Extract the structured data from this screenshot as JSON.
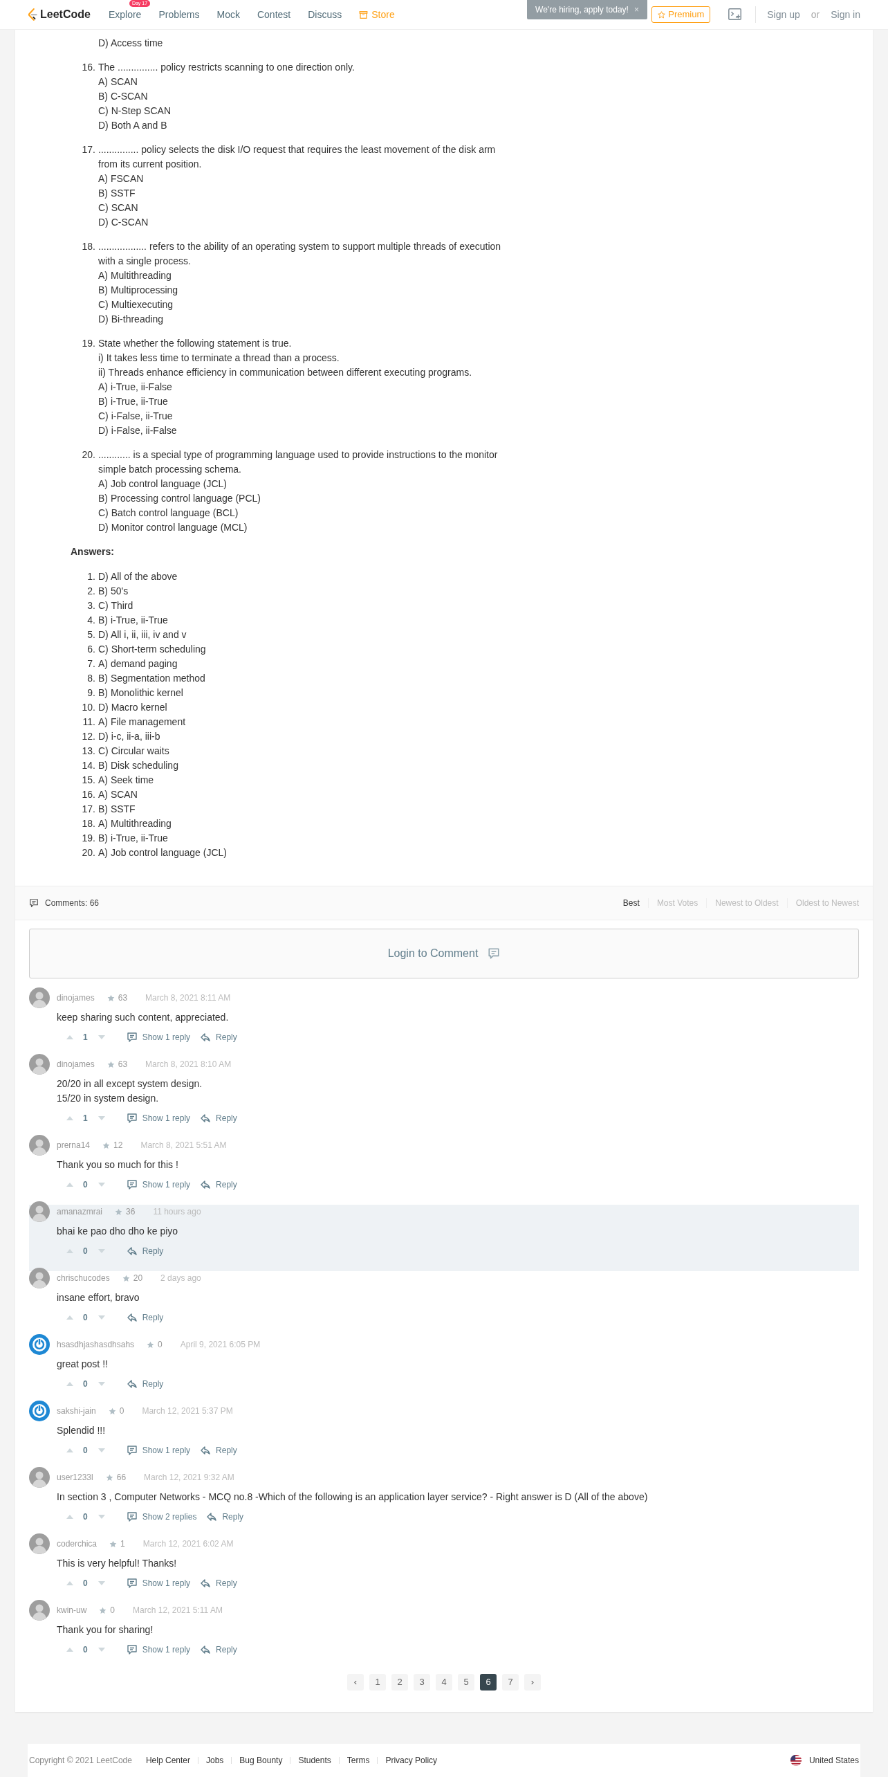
{
  "header": {
    "logo": "LeetCode",
    "nav": [
      {
        "label": "Explore",
        "badge": "Day 17",
        "kind": "link"
      },
      {
        "label": "Problems",
        "kind": "link"
      },
      {
        "label": "Mock",
        "kind": "link"
      },
      {
        "label": "Contest",
        "kind": "link"
      },
      {
        "label": "Discuss",
        "kind": "link"
      },
      {
        "label": "Store",
        "kind": "store"
      }
    ],
    "premium": "Premium",
    "sign_up": "Sign up",
    "or": "or",
    "sign_in": "Sign in",
    "toast": {
      "text": "We're hiring, apply today!",
      "close": "×"
    }
  },
  "partial_question": {
    "options": [
      "D) Access time"
    ]
  },
  "questions": [
    {
      "number": "16.",
      "text_lines": [
        "The ............... policy restricts scanning to one direction only."
      ],
      "options": [
        "A) SCAN",
        "B) C-SCAN",
        "C) N-Step SCAN",
        "D) Both A and B"
      ]
    },
    {
      "number": "17.",
      "text_lines": [
        "............... policy selects the disk I/O request that requires the least movement of the disk arm",
        "from its current position."
      ],
      "options": [
        "A) FSCAN",
        "B) SSTF",
        "C) SCAN",
        "D) C-SCAN"
      ]
    },
    {
      "number": "18.",
      "text_lines": [
        ".................. refers to the ability of an operating system to support multiple threads of execution",
        "with a single process."
      ],
      "options": [
        "A) Multithreading",
        "B) Multiprocessing",
        "C) Multiexecuting",
        "D) Bi-threading"
      ]
    },
    {
      "number": "19.",
      "text_lines": [
        "State whether the following statement is true.",
        "i) It takes less time to terminate a thread than a process.",
        "ii) Threads enhance efficiency in communication between different executing programs."
      ],
      "options": [
        "A) i-True, ii-False",
        "B) i-True, ii-True",
        "C) i-False, ii-True",
        "D) i-False, ii-False"
      ]
    },
    {
      "number": "20.",
      "text_lines": [
        "............ is a special type of programming language used to provide instructions to the monitor",
        "simple batch processing schema."
      ],
      "options": [
        "A) Job control language (JCL)",
        "B) Processing control language (PCL)",
        "C) Batch control language (BCL)",
        "D) Monitor control language (MCL)"
      ]
    }
  ],
  "answers": {
    "heading": "Answers:",
    "items": [
      {
        "number": "1.",
        "text": "D) All of the above"
      },
      {
        "number": "2.",
        "text": "B) 50's"
      },
      {
        "number": "3.",
        "text": "C) Third"
      },
      {
        "number": "4.",
        "text": "B) i-True, ii-True"
      },
      {
        "number": "5.",
        "text": "D) All i, ii, iii, iv and v"
      },
      {
        "number": "6.",
        "text": "C) Short-term scheduling"
      },
      {
        "number": "7.",
        "text": "A) demand paging"
      },
      {
        "number": "8.",
        "text": "B) Segmentation method"
      },
      {
        "number": "9.",
        "text": "B) Monolithic kernel"
      },
      {
        "number": "10.",
        "text": "D) Macro kernel"
      },
      {
        "number": "11.",
        "text": "A) File management"
      },
      {
        "number": "12.",
        "text": "D) i-c, ii-a, iii-b"
      },
      {
        "number": "13.",
        "text": "C) Circular waits"
      },
      {
        "number": "14.",
        "text": "B) Disk scheduling"
      },
      {
        "number": "15.",
        "text": "A) Seek time"
      },
      {
        "number": "16.",
        "text": "A) SCAN"
      },
      {
        "number": "17.",
        "text": "B) SSTF"
      },
      {
        "number": "18.",
        "text": "A) Multithreading"
      },
      {
        "number": "19.",
        "text": "B) i-True, ii-True"
      },
      {
        "number": "20.",
        "text": "A) Job control language (JCL)"
      }
    ]
  },
  "comments_bar": {
    "count_label": "Comments: 66",
    "sort_tabs": [
      {
        "label": "Best",
        "selected": true
      },
      {
        "label": "Most Votes",
        "selected": false
      },
      {
        "label": "Newest to Oldest",
        "selected": false
      },
      {
        "label": "Oldest to Newest",
        "selected": false
      }
    ]
  },
  "login_to_comment": "Login to Comment",
  "comments": [
    {
      "user": "dinojames",
      "kind": "photo",
      "reputation": "63",
      "date": "March 8, 2021 8:11 AM",
      "body": [
        "keep sharing such content, appreciated."
      ],
      "votes": "1",
      "replies": "Show 1 reply",
      "reply": "Reply",
      "highlighted": false
    },
    {
      "user": "dinojames",
      "kind": "photo",
      "reputation": "63",
      "date": "March 8, 2021 8:10 AM",
      "body": [
        "20/20 in all except system design.",
        "15/20 in system design."
      ],
      "votes": "1",
      "replies": "Show 1 reply",
      "reply": "Reply",
      "highlighted": false
    },
    {
      "user": "prerna14",
      "kind": "photo",
      "reputation": "12",
      "date": "March 8, 2021 5:51 AM",
      "body": [
        "Thank you so much for this !"
      ],
      "votes": "0",
      "replies": "Show 1 reply",
      "reply": "Reply",
      "highlighted": false
    },
    {
      "user": "amanazmrai",
      "kind": "photo",
      "reputation": "36",
      "date": "11 hours ago",
      "body": [
        "bhai ke pao dho dho ke piyo"
      ],
      "votes": "0",
      "reply": "Reply",
      "highlighted": true
    },
    {
      "user": "chrischucodes",
      "kind": "photo",
      "reputation": "20",
      "date": "2 days ago",
      "body": [
        "insane effort, bravo"
      ],
      "votes": "0",
      "reply": "Reply",
      "highlighted": false
    },
    {
      "user": "hsasdhjashasdhsahs",
      "kind": "default",
      "reputation": "0",
      "date": "April 9, 2021 6:05 PM",
      "body": [
        "great post !!"
      ],
      "votes": "0",
      "reply": "Reply",
      "highlighted": false
    },
    {
      "user": "sakshi-jain",
      "kind": "default",
      "reputation": "0",
      "date": "March 12, 2021 5:37 PM",
      "body": [
        "Splendid !!!"
      ],
      "votes": "0",
      "replies": "Show 1 reply",
      "reply": "Reply",
      "highlighted": false
    },
    {
      "user": "user1233l",
      "kind": "photo",
      "reputation": "66",
      "date": "March 12, 2021 9:32 AM",
      "body": [
        "In section 3 , Computer Networks - MCQ no.8 -Which of the following is an application layer service? - Right answer is D (All of the above)"
      ],
      "votes": "0",
      "replies": "Show 2 replies",
      "reply": "Reply",
      "highlighted": false
    },
    {
      "user": "coderchica",
      "kind": "photo",
      "reputation": "1",
      "date": "March 12, 2021 6:02 AM",
      "body": [
        "This is very helpful! Thanks!"
      ],
      "votes": "0",
      "replies": "Show 1 reply",
      "reply": "Reply",
      "highlighted": false
    },
    {
      "user": "kwin-uw",
      "kind": "photo",
      "reputation": "0",
      "date": "March 12, 2021 5:11 AM",
      "body": [
        "Thank you for sharing!"
      ],
      "votes": "0",
      "replies": "Show 1 reply",
      "reply": "Reply",
      "highlighted": false
    }
  ],
  "pagination": {
    "prev": "‹",
    "next": "›",
    "pages": [
      {
        "label": "1",
        "selected": false
      },
      {
        "label": "2",
        "selected": false
      },
      {
        "label": "3",
        "selected": false
      },
      {
        "label": "4",
        "selected": false
      },
      {
        "label": "5",
        "selected": false
      },
      {
        "label": "6",
        "selected": true
      },
      {
        "label": "7",
        "selected": false
      }
    ]
  },
  "footer": {
    "copyright": "Copyright © 2021 LeetCode",
    "links": [
      "Help Center",
      "Jobs",
      "Bug Bounty",
      "Students",
      "Terms",
      "Privacy Policy"
    ],
    "region": "United States"
  }
}
